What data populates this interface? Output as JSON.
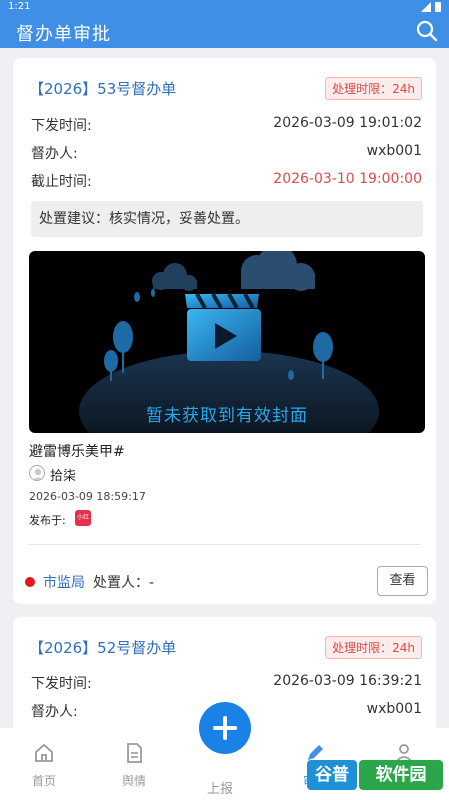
{
  "status_bar": {
    "time": "1:21"
  },
  "app_bar": {
    "title": "督办单审批"
  },
  "cards": [
    {
      "title": "【2026】53号督办单",
      "badge": "处理时限：24h",
      "rows": [
        {
          "label": "下发时间:",
          "value": "2026-03-09 19:01:02"
        },
        {
          "label": "督办人:",
          "value": "wxb001"
        },
        {
          "label": "截止时间:",
          "value": "2026-03-10 19:00:00"
        }
      ],
      "advice": "处置建议：核实情况，妥善处置。",
      "video": {
        "cover_text": "暂未获取到有效封面",
        "title": "避雷博乐美甲#",
        "author": "拾柒",
        "time": "2026-03-09 18:59:17",
        "publish_label": "发布于:",
        "platform": "小红书"
      },
      "department": "市监局",
      "handler": "处置人：-",
      "view_button": "查看"
    },
    {
      "title": "【2026】52号督办单",
      "badge": "处理时限：24h",
      "rows": [
        {
          "label": "下发时间:",
          "value": "2026-03-09 16:39:21"
        },
        {
          "label": "督办人:",
          "value": "wxb001"
        }
      ]
    }
  ],
  "bottom_nav": {
    "home": "首页",
    "opinion": "舆情",
    "report": "上报",
    "approval": "审批",
    "mine": "我的"
  },
  "watermark": {
    "logo": "谷普",
    "text": "软件园"
  },
  "colors": {
    "primary": "#3f8fe6",
    "link": "#2f6fc0",
    "danger": "#e04848",
    "fab": "#1a82e6"
  }
}
